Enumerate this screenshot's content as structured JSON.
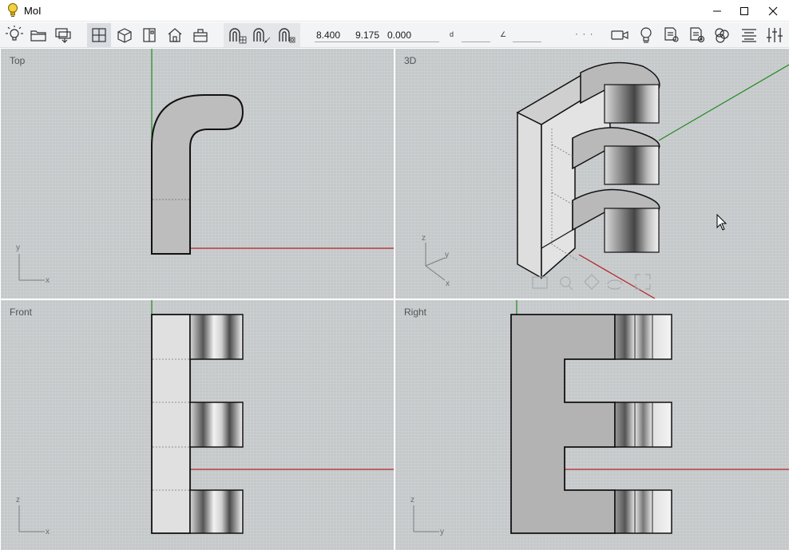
{
  "window": {
    "title": "MoI",
    "app_icon": "lightbulb-icon",
    "controls": [
      "minimize-icon",
      "maximize-icon",
      "close-icon"
    ]
  },
  "toolbar": {
    "left_icons": [
      "lightbulb-menu-icon",
      "open-folder-icon",
      "export-icon"
    ],
    "view_icons": [
      "split-view-icon",
      "3d-view-icon",
      "front-view-icon",
      "home-view-icon",
      "hide-icon"
    ],
    "snap_icons": [
      "grid-snap-icon",
      "straight-snap-icon",
      "object-snap-icon"
    ],
    "coords": {
      "x": "8.400",
      "y": "9.175",
      "z": "0.000"
    },
    "distance_symbol": "d",
    "angle_symbol": "∠",
    "overflow": "· · ·",
    "right_icons": [
      "camera-icon",
      "light-icon",
      "properties-icon",
      "settings-icon",
      "styles-icon",
      "align-icon",
      "sliders-icon"
    ]
  },
  "viewports": {
    "top": {
      "label": "Top",
      "axes": {
        "vertical": "y",
        "horizontal": "x"
      }
    },
    "three_d": {
      "label": "3D",
      "axes": {
        "a": "z",
        "b": "y",
        "c": "x"
      }
    },
    "front": {
      "label": "Front",
      "axes": {
        "vertical": "z",
        "horizontal": "x"
      }
    },
    "right": {
      "label": "Right",
      "axes": {
        "vertical": "z",
        "horizontal": "y"
      }
    }
  },
  "view_controls": [
    "frame-icon",
    "zoom-icon",
    "pan-icon",
    "rotate-icon",
    "fullscreen-icon"
  ],
  "colors": {
    "x_axis": "#b22222",
    "y_axis": "#1f8a1f",
    "solid": "#bdbdbd",
    "solid_light": "#e0e0e0",
    "edge": "#1a1a1a"
  }
}
